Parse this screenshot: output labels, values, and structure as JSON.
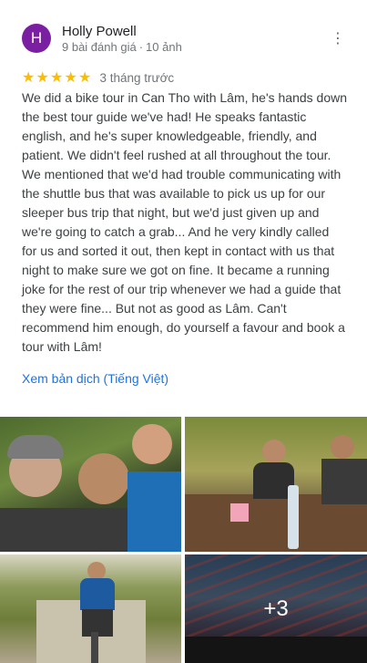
{
  "reviewer": {
    "initial": "H",
    "name": "Holly Powell",
    "reviews_count": "9 bài đánh giá",
    "photos_count": "10 ảnh",
    "avatar_color": "#7b1fa2"
  },
  "rating": {
    "stars": 5,
    "time_ago": "3 tháng trước",
    "star_color": "#fbbc04"
  },
  "review_lines": [
    "We did a bike tour in Can Tho with Lâm, he's hands down",
    "the best tour guide we've had! He speaks fantastic",
    "english, and he's super knowledgeable, friendly, and",
    "patient. We didn't feel rushed at all throughout the tour.",
    "We mentioned that we'd had trouble communicating with",
    "the shuttle bus that was available to pick us up for our",
    "sleeper bus trip that night, but we'd just given up and",
    "we're going to catch a grab... And he very kindly called",
    "for us and sorted it out, then kept in contact with us that",
    "night to make sure we got on fine. It became a running",
    "joke for the rest of our trip whenever we had a guide that",
    "they were fine... But not as good as Lâm. Can't",
    "recommend him enough, do yourself a favour and book a",
    "tour with Lâm!"
  ],
  "translate_link": "Xem bản dịch (Tiếng Việt)",
  "photos": {
    "more_count": "+3"
  },
  "icons": {
    "more": "more-vert-icon",
    "star": "star-icon"
  }
}
